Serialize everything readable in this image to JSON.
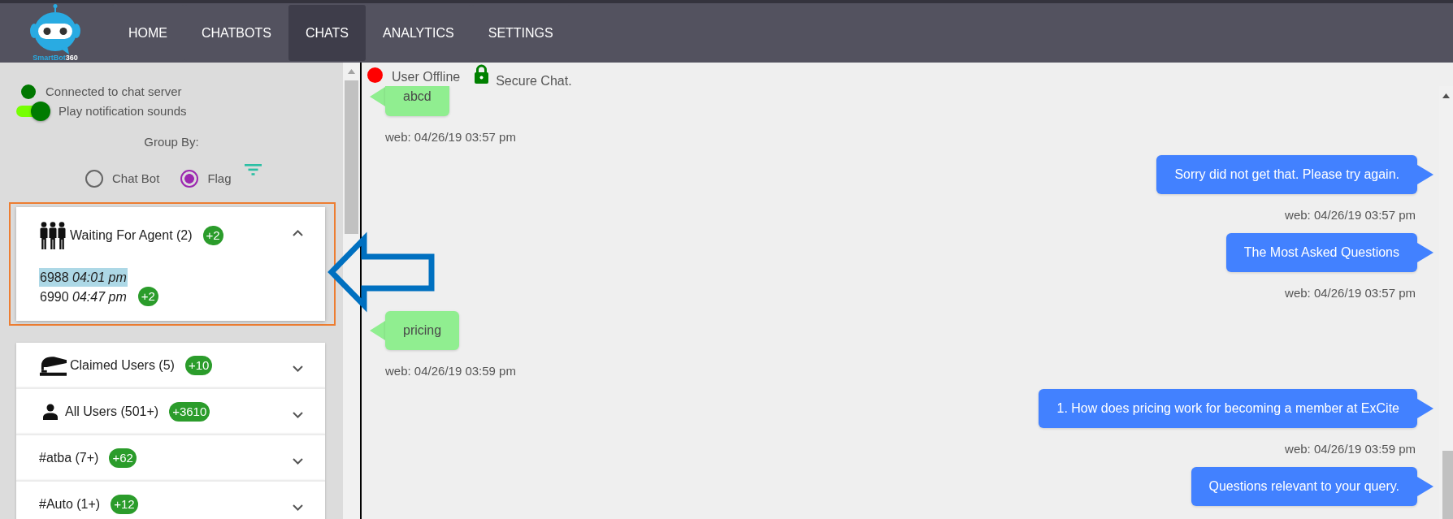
{
  "header": {
    "logo": {
      "name": "SmartBot",
      "suffix": "360"
    },
    "nav": [
      {
        "label": "HOME",
        "selected": false
      },
      {
        "label": "CHATBOTS",
        "selected": false
      },
      {
        "label": "CHATS",
        "selected": true
      },
      {
        "label": "ANALYTICS",
        "selected": false
      },
      {
        "label": "SETTINGS",
        "selected": false
      }
    ]
  },
  "sidebar": {
    "server_status": {
      "text": "Connected to chat server",
      "connected": true
    },
    "sound_toggle": {
      "label": "Play notification sounds",
      "on": true
    },
    "group_by": {
      "label": "Group By:",
      "options": [
        {
          "label": "Chat Bot",
          "selected": false
        },
        {
          "label": "Flag",
          "selected": true
        }
      ]
    },
    "groups": [
      {
        "kind": "waiting",
        "title": "Waiting For Agent (2)",
        "badge": "+2",
        "expanded": true,
        "outlined": true,
        "chats": [
          {
            "id": "6988",
            "time": "04:01 pm",
            "highlighted": true
          },
          {
            "id": "6990",
            "time": "04:47 pm",
            "highlighted": false,
            "badge": "+2"
          }
        ]
      },
      {
        "kind": "claimed",
        "title": "Claimed Users (5)",
        "badge": "+10",
        "expanded": false,
        "outlined": false
      },
      {
        "kind": "all_users",
        "title": "All Users (501+)",
        "badge": "+3610",
        "expanded": false,
        "outlined": false
      },
      {
        "kind": "tag",
        "title": "#atba (7+)",
        "badge": "+62",
        "expanded": false,
        "outlined": false
      },
      {
        "kind": "tag",
        "title": "#Auto (1+)",
        "badge": "+12",
        "expanded": false,
        "outlined": false
      }
    ]
  },
  "chat": {
    "user_status": {
      "text": "User Offline",
      "online": false
    },
    "security_label": "Secure Chat.",
    "messages": [
      {
        "kind": "received",
        "text": "abcd",
        "time": "web: 04/26/19 03:57 pm"
      },
      {
        "kind": "sent",
        "text": "Sorry did not get that. Please try again.",
        "time": "web: 04/26/19 03:57 pm"
      },
      {
        "kind": "sent",
        "text": "The Most Asked Questions",
        "time": "web: 04/26/19 03:57 pm"
      },
      {
        "kind": "received",
        "text": "pricing",
        "time": "web: 04/26/19 03:59 pm"
      },
      {
        "kind": "sent",
        "text": "1. How does pricing work for becoming a member at ExCite",
        "time": "web: 04/26/19 03:59 pm"
      },
      {
        "kind": "sent",
        "text": "Questions relevant to your query."
      }
    ]
  },
  "pointer_arrow": true
}
